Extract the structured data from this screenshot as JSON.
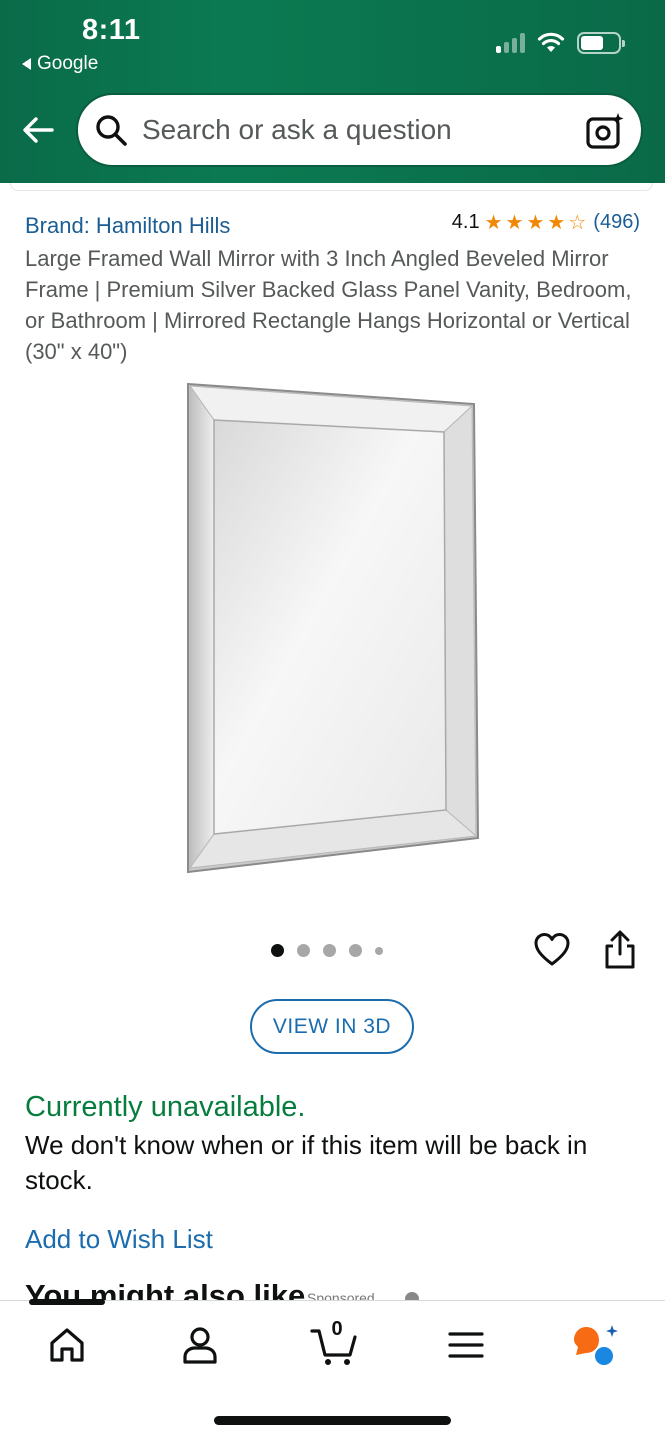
{
  "status_bar": {
    "time": "8:11",
    "back_app": "Google"
  },
  "search": {
    "placeholder": "Search or ask a question"
  },
  "product": {
    "brand": "Brand: Hamilton Hills",
    "rating_value": "4.1",
    "rating_stars": 4.1,
    "rating_count": "(496)",
    "title": "Large Framed Wall Mirror with 3 Inch Angled Beveled Mirror Frame | Premium Silver Backed Glass Panel Vanity, Bedroom, or Bathroom | Mirrored Rectangle Hangs Horizontal or Vertical (30\" x 40\")"
  },
  "gallery": {
    "image_count": 5,
    "active_index": 0
  },
  "view_3d_label": "VIEW IN 3D",
  "availability": {
    "status": "Currently unavailable.",
    "description": "We don't know when or if this item will be back in stock."
  },
  "wishlist_label": "Add to Wish List",
  "also_like": {
    "heading": "You might also like",
    "sponsored": "Sponsored"
  },
  "bottom_nav": {
    "items": [
      "home-icon",
      "account-icon",
      "cart-icon",
      "menu-icon",
      "rufus-icon"
    ],
    "cart_count": "0",
    "active": "home"
  },
  "colors": {
    "header_green": "#0a6b49",
    "link_blue": "#1b6cae",
    "available_green": "#067d3e",
    "star_orange": "#f08804"
  }
}
